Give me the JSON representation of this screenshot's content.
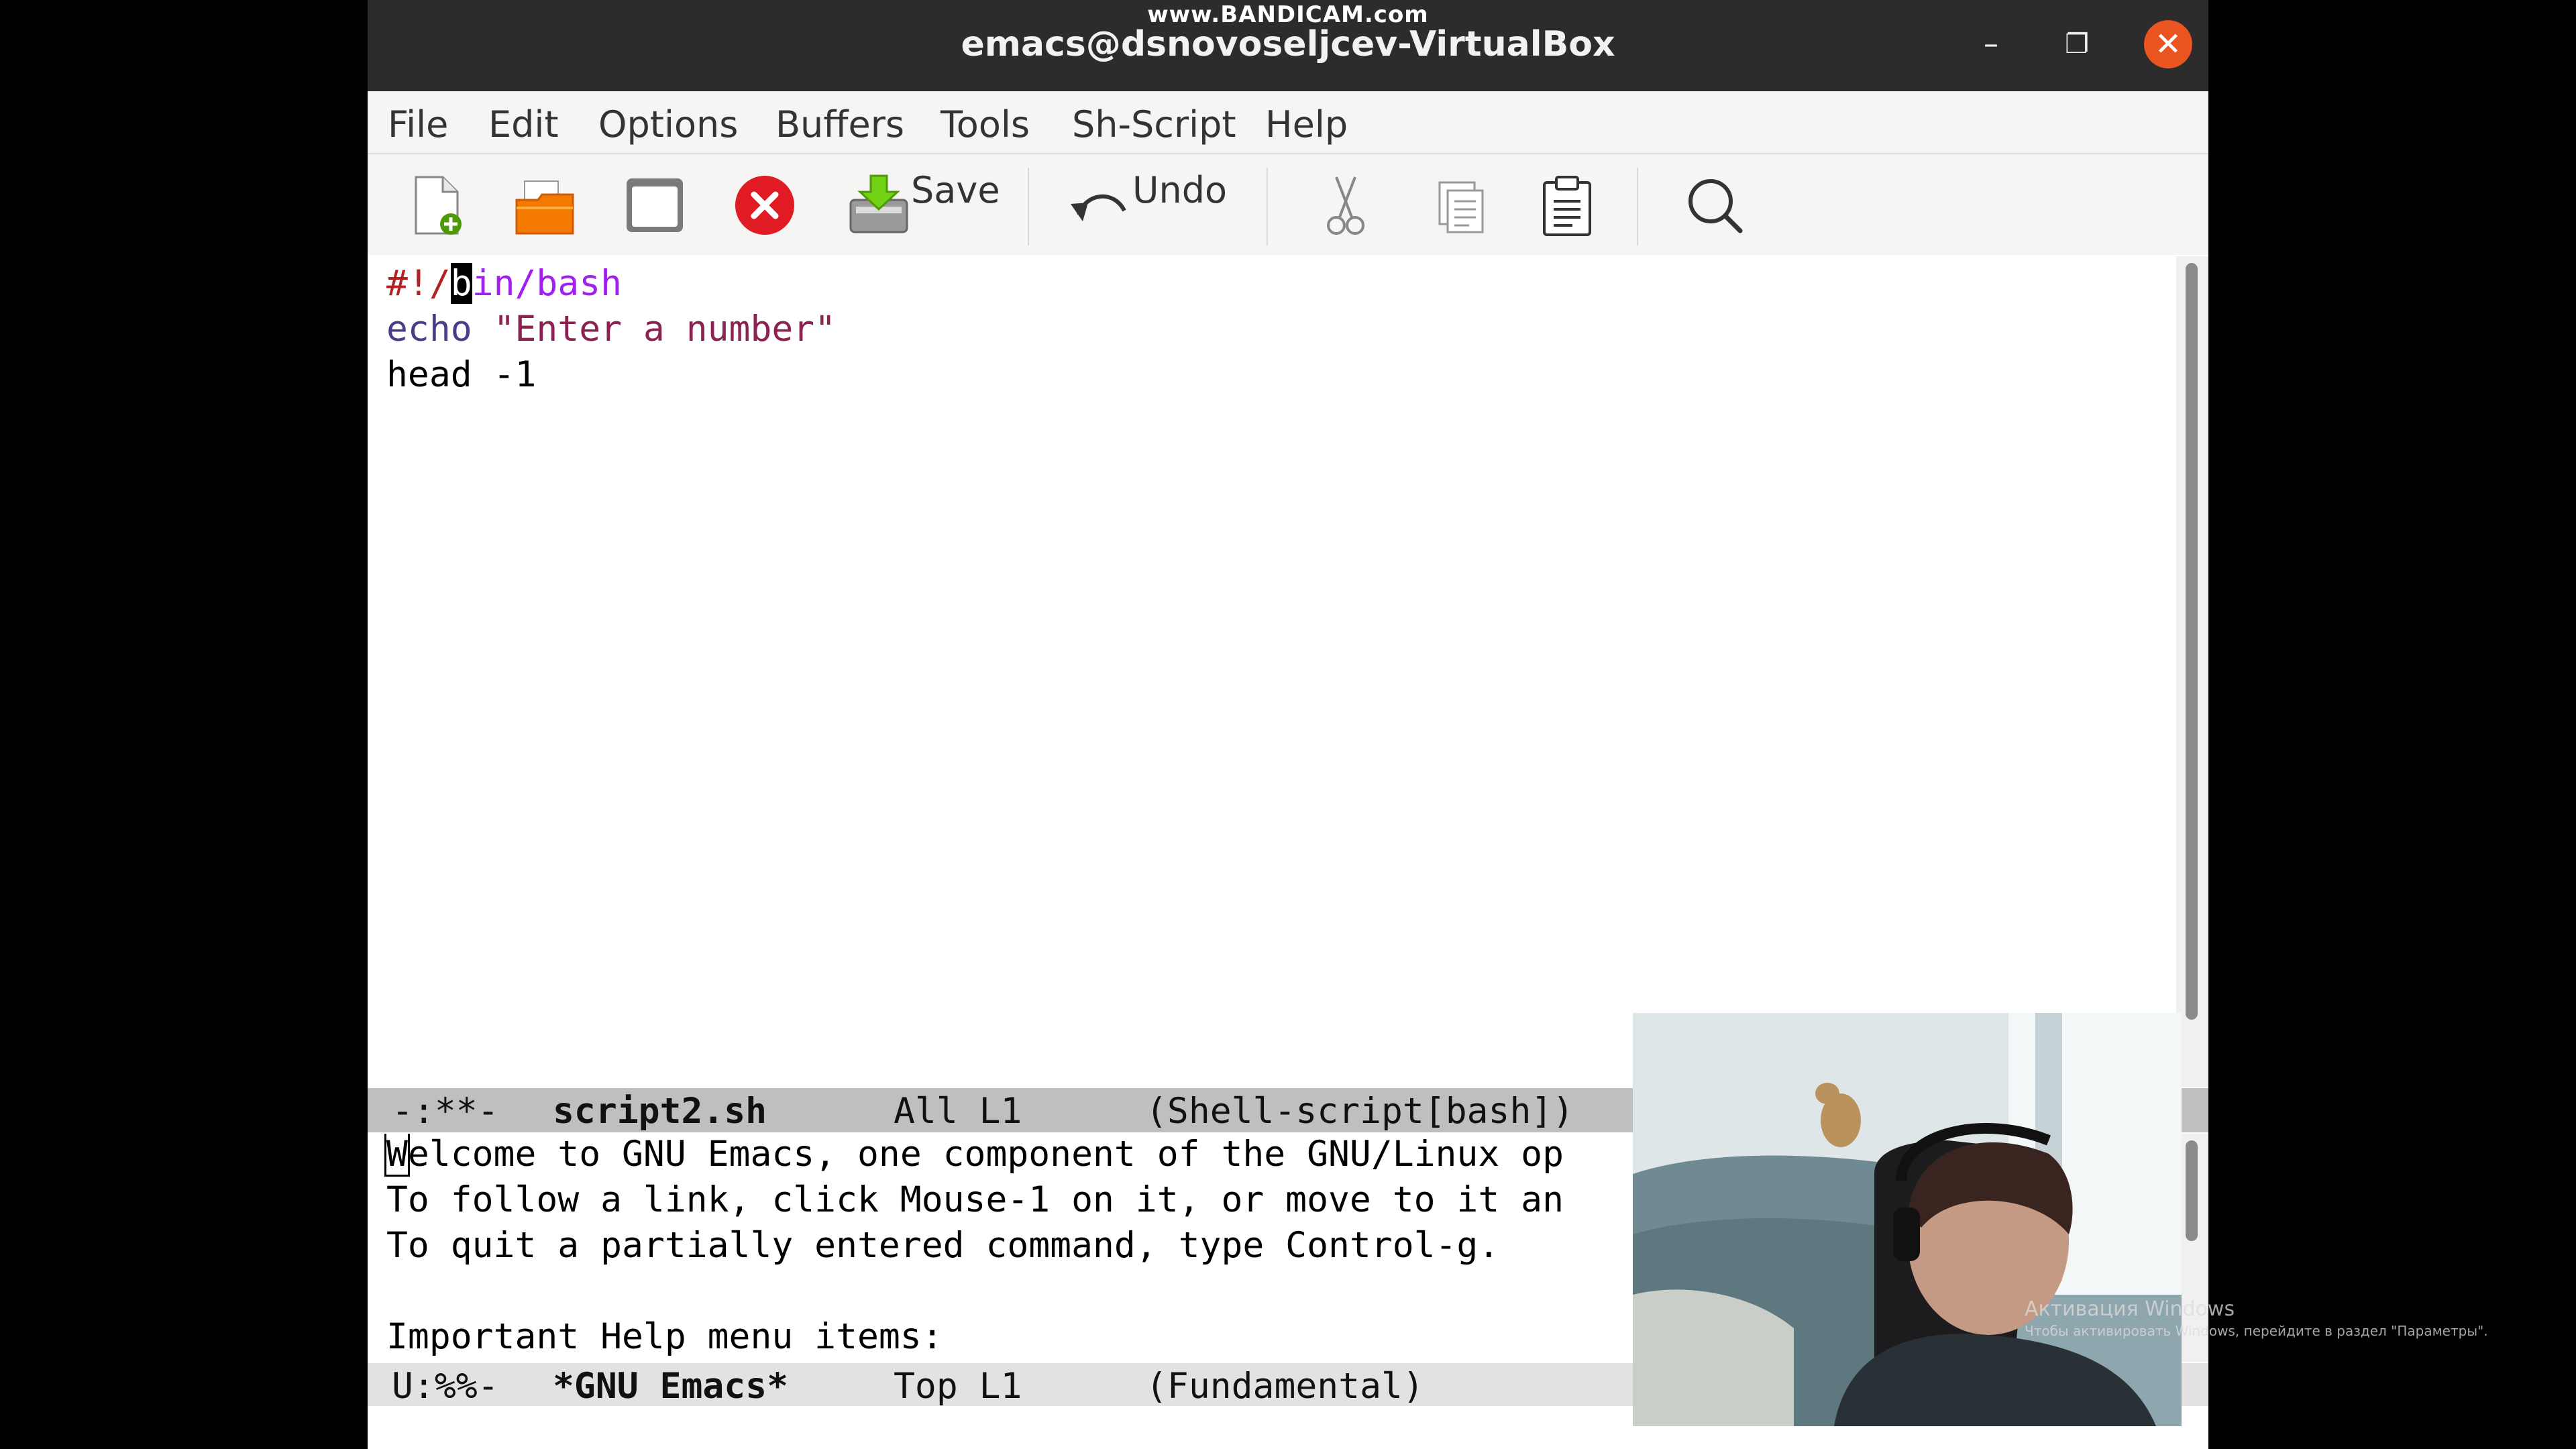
{
  "window": {
    "watermark": "www.BANDICAM.com",
    "title": "emacs@dsnovoseljcev-VirtualBox",
    "controls": {
      "minimize": "–",
      "maximize": "❐",
      "close": "✕"
    }
  },
  "menu": [
    "File",
    "Edit",
    "Options",
    "Buffers",
    "Tools",
    "Sh-Script",
    "Help"
  ],
  "toolbar": {
    "save_label": "Save",
    "undo_label": "Undo"
  },
  "editor": {
    "shebang_prefix": "#!/",
    "cursor_char": "b",
    "shebang_rest": "in/bash",
    "echo_kw": "echo",
    "echo_str": "\"Enter a number\"",
    "line3": "head -1",
    "modeline": {
      "state": "-:**-",
      "buffer": "script2.sh",
      "pos": "All L1",
      "mode": "(Shell-script[bash])"
    }
  },
  "help": {
    "line1_cursor": "W",
    "line1_rest": "elcome to GNU Emacs, one component of the GNU/Linux op",
    "line2": "To follow a link, click Mouse-1 on it, or move to it an",
    "line3": "To quit a partially entered command, type Control-g.",
    "line4": "Important Help menu items:",
    "modeline": {
      "state": "U:%%-",
      "buffer": "*GNU Emacs*",
      "pos": "Top L1",
      "mode": "(Fundamental)"
    }
  },
  "overlay": {
    "activation_title": "Активация Windows",
    "activation_text": "Чтобы активировать Windows, перейдите в раздел \"Параметры\"."
  },
  "colors": {
    "titlebar": "#2c2c2c",
    "close_button": "#e95420",
    "shebang": "#b22222",
    "shebang_path": "#a020f0",
    "keyword": "#483d8b",
    "string": "#8b2252",
    "modeline_active": "#bfbfbf"
  }
}
